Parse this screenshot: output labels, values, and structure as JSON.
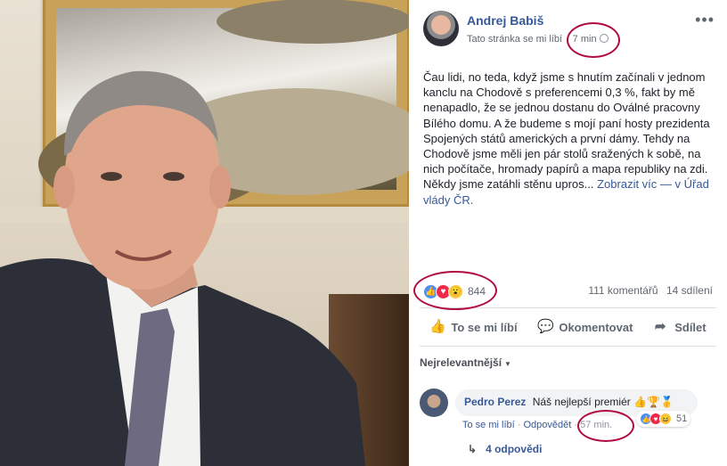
{
  "post": {
    "author": "Andrej Babiš",
    "page_label": "Tato stránka se mi líbí",
    "time": "7 min",
    "text_main": "Čau lidi, no teda, když jsme s hnutím začínali v jednom kanclu na Chodově s preferencemi 0,3 %, fakt by mě nenapadlo, že se jednou dostanu do Oválné pracovny Bílého domu. A že budeme s mojí paní hosty prezidenta Spojených států amerických a první dámy. Tehdy na Chodově jsme měli jen pár stolů sražených k sobě, na nich počítače, hromady papírů a mapa republiky na zdi. Někdy jsme zatáhli stěnu upros...",
    "see_more": "Zobrazit víc",
    "location": "— v Úřad vlády ČR.",
    "reaction_count": "844",
    "comments_count": "111 komentářů",
    "shares_count": "14 sdílení"
  },
  "actions": {
    "like": "To se mi líbí",
    "comment": "Okomentovat",
    "share": "Sdílet"
  },
  "sort_label": "Nejrelevantnější",
  "comment": {
    "author": "Pedro Perez",
    "text": "Náš nejlepší premiér",
    "emojis": "👍🏆🥇",
    "reactions": "51",
    "like_link": "To se mi líbí",
    "reply_link": "Odpovědět",
    "time": "57 min."
  },
  "replies_label": "4 odpovědi",
  "colors": {
    "link": "#365899",
    "annotation": "#b00b3e"
  }
}
